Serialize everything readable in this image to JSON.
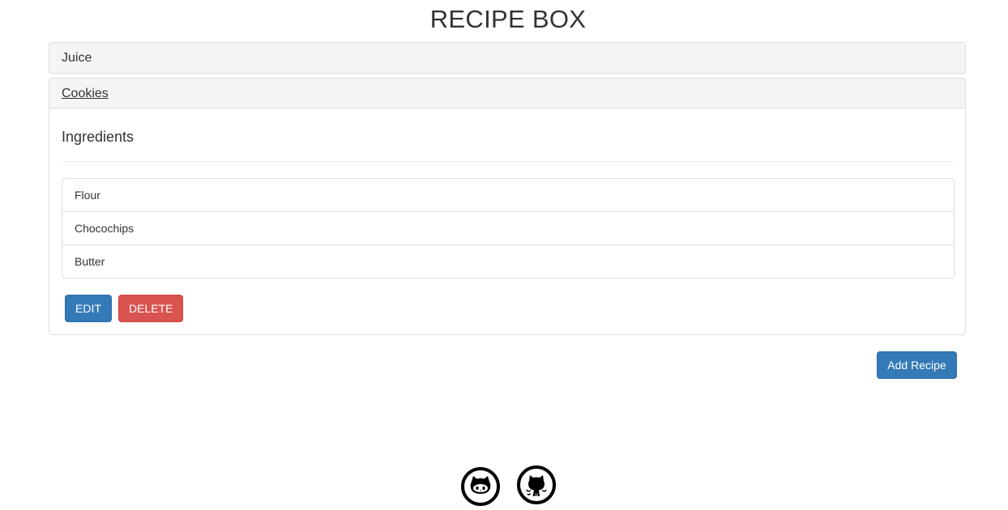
{
  "app": {
    "title": "RECIPE BOX"
  },
  "recipes": [
    {
      "name": "Juice",
      "expanded": false
    },
    {
      "name": "Cookies",
      "expanded": true,
      "ingredients_heading": "Ingredients",
      "ingredients": [
        "Flour",
        "Chocochips",
        "Butter"
      ],
      "edit_label": "EDIT",
      "delete_label": "DELETE"
    }
  ],
  "actions": {
    "add_recipe_label": "Add Recipe"
  },
  "footer": {
    "icons": [
      "github-octocat-icon",
      "github-octocat-icon"
    ]
  },
  "colors": {
    "primary": "#337ab7",
    "danger": "#d9534f",
    "panel_heading_bg": "#f5f5f5",
    "border": "#dddddd",
    "text": "#333333"
  }
}
